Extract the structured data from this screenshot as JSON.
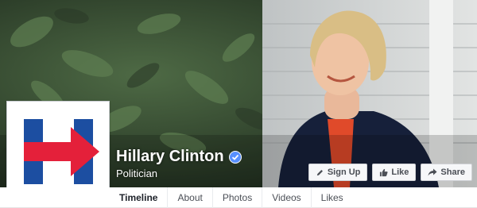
{
  "page": {
    "name": "Hillary Clinton",
    "category": "Politician",
    "verified": true
  },
  "colors": {
    "logo_blue": "#1c4ea1",
    "logo_red": "#e4203a",
    "verified_blue": "#5890ff"
  },
  "actions": [
    {
      "label": "Sign Up",
      "icon": "pencil-icon"
    },
    {
      "label": "Like",
      "icon": "thumbs-up-icon"
    },
    {
      "label": "Share",
      "icon": "share-arrow-icon"
    }
  ],
  "tabs": [
    {
      "label": "Timeline",
      "active": true
    },
    {
      "label": "About",
      "active": false
    },
    {
      "label": "Photos",
      "active": false
    },
    {
      "label": "Videos",
      "active": false
    },
    {
      "label": "Likes",
      "active": false
    }
  ]
}
